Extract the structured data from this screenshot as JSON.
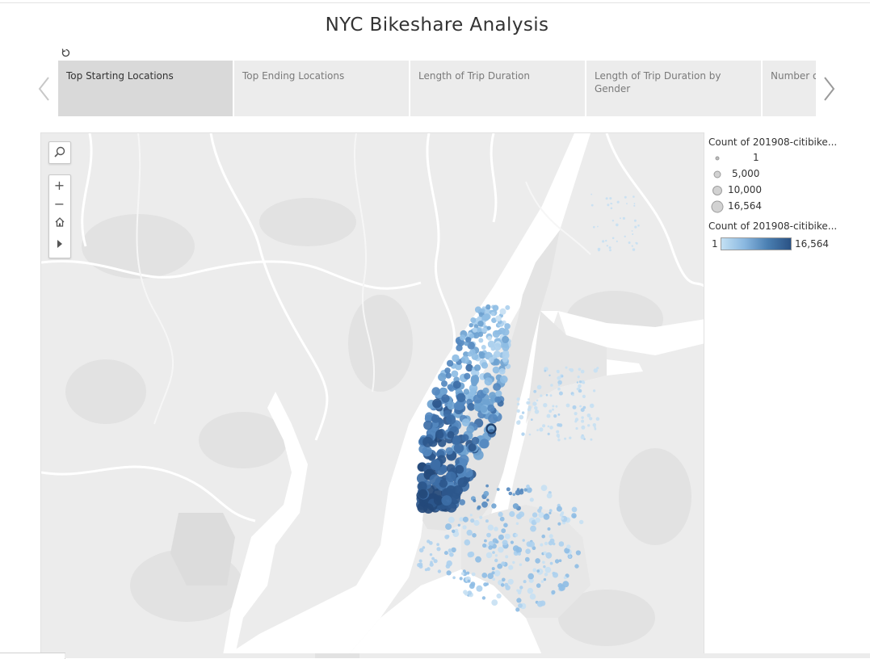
{
  "dashboard": {
    "title": "NYC Bikeshare Analysis"
  },
  "story": {
    "tabs": [
      {
        "label": "Top Starting Locations",
        "active": true
      },
      {
        "label": "Top Ending Locations",
        "active": false
      },
      {
        "label": "Length of Trip Duration",
        "active": false
      },
      {
        "label": "Length of Trip Duration by Gender",
        "active": false
      },
      {
        "label": "Number of Trips by Hour",
        "active": false
      }
    ],
    "icons": {
      "revert": "revert-icon",
      "prev": "chevron-left-icon",
      "next": "chevron-right-icon"
    }
  },
  "map_tools": {
    "search": "search-icon",
    "zoom_in": "+",
    "zoom_out": "−",
    "home": "home-icon",
    "expand": "play-icon"
  },
  "legend": {
    "size_title": "Count of 201908-citibike...",
    "size_items": [
      {
        "label": "1",
        "value": 1
      },
      {
        "label": "5,000",
        "value": 5000
      },
      {
        "label": "10,000",
        "value": 10000
      },
      {
        "label": "16,564",
        "value": 16564
      }
    ],
    "color_title": "Count of 201908-citibike...",
    "color_min": "1",
    "color_max": "16,564"
  },
  "colors": {
    "low": "#b8d8f0",
    "mid": "#6fa3d1",
    "high": "#24497a",
    "land": "#e9e9e9",
    "water": "#ffffff"
  }
}
